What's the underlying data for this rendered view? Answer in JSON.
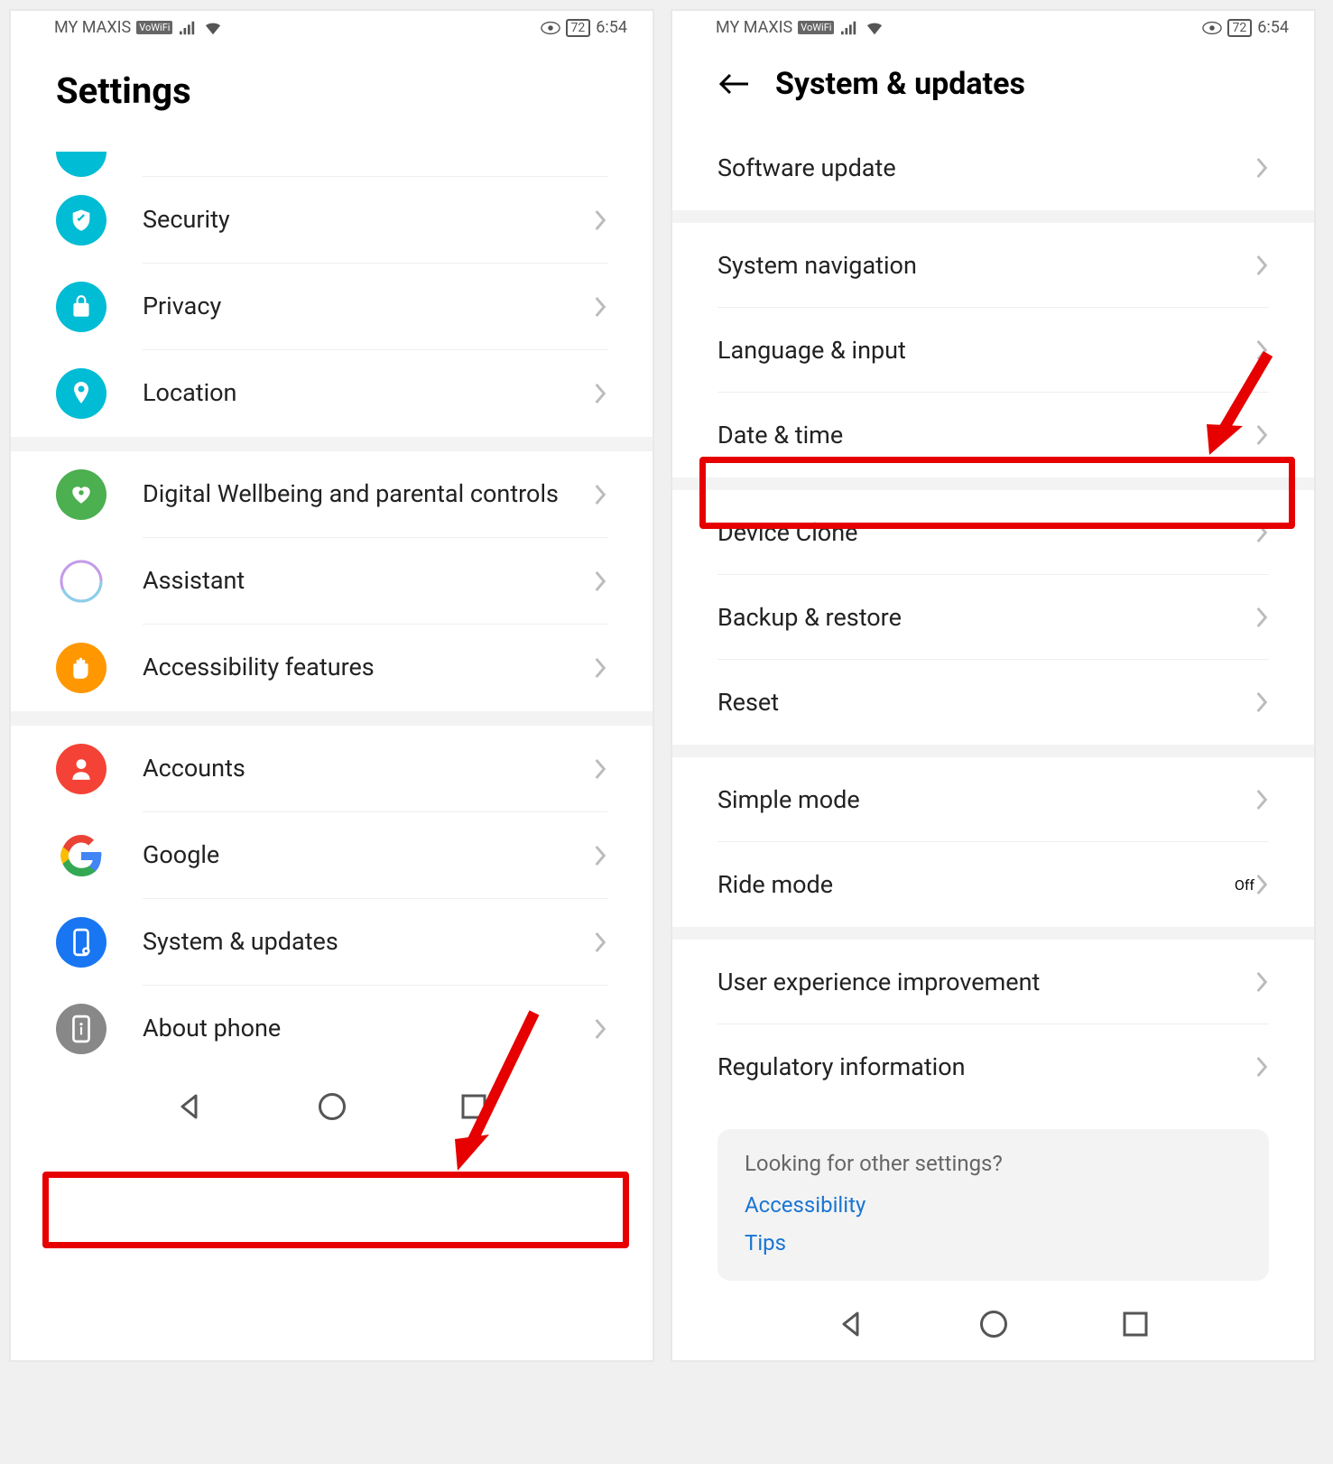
{
  "status": {
    "carrier": "MY MAXIS",
    "vowifi": "VoWiFi",
    "battery": "72",
    "time": "6:54"
  },
  "left": {
    "title": "Settings",
    "items": {
      "security": "Security",
      "privacy": "Privacy",
      "location": "Location",
      "wellbeing": "Digital Wellbeing and parental controls",
      "assistant": "Assistant",
      "accessibility": "Accessibility features",
      "accounts": "Accounts",
      "google": "Google",
      "system": "System & updates",
      "about": "About phone"
    }
  },
  "right": {
    "title": "System & updates",
    "items": {
      "software": "Software update",
      "navigation": "System navigation",
      "language": "Language & input",
      "datetime": "Date & time",
      "clone": "Device Clone",
      "backup": "Backup & restore",
      "reset": "Reset",
      "simple": "Simple mode",
      "ride": "Ride mode",
      "ride_value": "Off",
      "ux": "User experience improvement",
      "regulatory": "Regulatory information"
    },
    "footer": {
      "question": "Looking for other settings?",
      "link1": "Accessibility",
      "link2": "Tips"
    }
  }
}
